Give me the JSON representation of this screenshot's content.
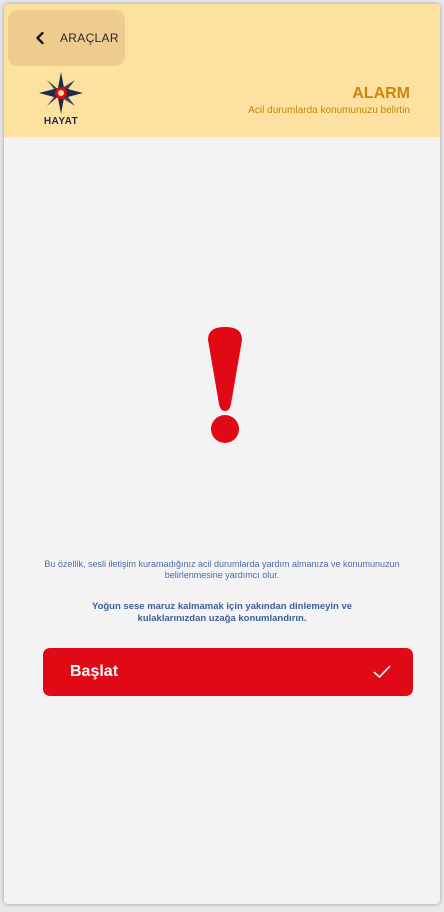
{
  "header": {
    "back_label": "ARAÇLAR",
    "logo_text": "HAYAT",
    "title": "ALARM",
    "subtitle": "Acil durumlarda konumunuzu belirtin"
  },
  "content": {
    "description": "Bu özellik, sesli iletişim kuramadığınız acil durumlarda yardım almanıza ve konumunuzun belirlenmesine yardımcı olur.",
    "warning": "Yoğun sese maruz kalmamak için yakından dinlemeyin ve kulaklarınızdan uzağa konumlandırın."
  },
  "start_button": {
    "label": "Başlat"
  },
  "icons": {
    "back": "chevron-left-icon",
    "logo": "star-compass-icon",
    "alert": "exclamation-icon",
    "confirm": "check-icon"
  },
  "colors": {
    "header_bg": "#fde1a0",
    "accent": "#c8860a",
    "alert_red": "#e10915",
    "text_blue": "#4a6ba8"
  }
}
